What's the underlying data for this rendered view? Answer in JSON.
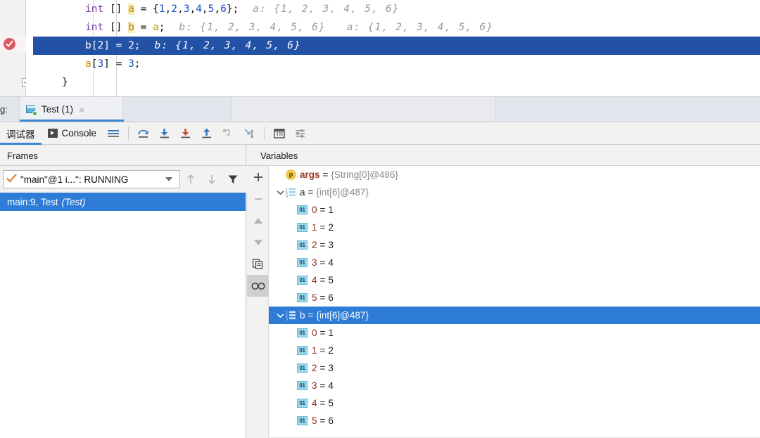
{
  "editor": {
    "lines": [
      {
        "tokens": [
          {
            "t": "int",
            "c": "kw"
          },
          {
            "t": " [] ",
            "c": "plain"
          },
          {
            "t": "a",
            "c": "ident"
          },
          {
            "t": " = {",
            "c": "plain"
          },
          {
            "t": "1",
            "c": "num"
          },
          {
            "t": ",",
            "c": "plain"
          },
          {
            "t": "2",
            "c": "num"
          },
          {
            "t": ",",
            "c": "plain"
          },
          {
            "t": "3",
            "c": "num"
          },
          {
            "t": ",",
            "c": "plain"
          },
          {
            "t": "4",
            "c": "num"
          },
          {
            "t": ",",
            "c": "plain"
          },
          {
            "t": "5",
            "c": "num"
          },
          {
            "t": ",",
            "c": "plain"
          },
          {
            "t": "6",
            "c": "num"
          },
          {
            "t": "};",
            "c": "plain"
          }
        ],
        "hints": [
          "a: {1, 2, 3, 4, 5, 6}"
        ],
        "selected": false,
        "breakpoint": false
      },
      {
        "tokens": [
          {
            "t": "int",
            "c": "kw"
          },
          {
            "t": " [] ",
            "c": "plain"
          },
          {
            "t": "b",
            "c": "ident"
          },
          {
            "t": " = ",
            "c": "plain"
          },
          {
            "t": "a",
            "c": "ident-plain"
          },
          {
            "t": ";",
            "c": "plain"
          }
        ],
        "hints": [
          "b: {1, 2, 3, 4, 5, 6}",
          "a: {1, 2, 3, 4, 5, 6}"
        ],
        "selected": false,
        "breakpoint": false
      },
      {
        "tokens": [
          {
            "t": "b[",
            "c": "plain"
          },
          {
            "t": "2",
            "c": "num"
          },
          {
            "t": "] = ",
            "c": "plain"
          },
          {
            "t": "2",
            "c": "num"
          },
          {
            "t": ";",
            "c": "plain"
          }
        ],
        "hints": [
          "b: {1, 2, 3, 4, 5, 6}"
        ],
        "selected": true,
        "breakpoint": true
      },
      {
        "tokens": [
          {
            "t": "a",
            "c": "ident-plain"
          },
          {
            "t": "[",
            "c": "plain"
          },
          {
            "t": "3",
            "c": "num"
          },
          {
            "t": "] = ",
            "c": "plain"
          },
          {
            "t": "3",
            "c": "num"
          },
          {
            "t": ";",
            "c": "plain"
          }
        ],
        "hints": [],
        "selected": false,
        "breakpoint": false
      },
      {
        "tokens": [
          {
            "t": "}",
            "c": "plain"
          }
        ],
        "hints": [],
        "selected": false,
        "breakpoint": false,
        "outdent": true
      }
    ]
  },
  "tabbar": {
    "prefix_label": "g:",
    "run_tab": {
      "title": "Test (1)",
      "icon": "run-configuration-icon",
      "close": "×",
      "status_dot_color": "#4caf50"
    }
  },
  "debug_toolbar": {
    "tabs": [
      {
        "label": "调试器",
        "icon": null,
        "active": true
      },
      {
        "label": "Console",
        "icon": "console-icon",
        "active": false
      }
    ],
    "buttons": [
      {
        "name": "show-execution-point-icon",
        "title": "Show Execution Point"
      },
      {
        "name": "step-over-icon",
        "title": "Step Over"
      },
      {
        "name": "step-into-icon",
        "title": "Step Into"
      },
      {
        "name": "force-step-into-icon",
        "title": "Force Step Into"
      },
      {
        "name": "step-out-icon",
        "title": "Step Out"
      },
      {
        "name": "drop-frame-icon",
        "title": "Drop Frame"
      },
      {
        "name": "run-to-cursor-icon",
        "title": "Run to Cursor"
      },
      {
        "name": "evaluate-expression-icon",
        "title": "Evaluate Expression"
      },
      {
        "name": "settings-icon",
        "title": "Settings"
      }
    ]
  },
  "frames": {
    "header": "Frames",
    "thread": {
      "label": "\"main\"@1 i...\": RUNNING",
      "status_icon": "check-icon"
    },
    "toolbar": [
      {
        "name": "frame-up-icon"
      },
      {
        "name": "frame-down-icon"
      },
      {
        "name": "filter-icon"
      }
    ],
    "rows": [
      {
        "label": "main:9, Test",
        "suffix": "(Test)",
        "selected": true
      }
    ]
  },
  "variables": {
    "header": "Variables",
    "strip_buttons": [
      {
        "name": "add-watch-icon",
        "glyph": "+",
        "active": false
      },
      {
        "name": "remove-watch-icon",
        "glyph": "−",
        "active": false
      },
      {
        "name": "move-up-icon",
        "glyph": "▲",
        "active": false
      },
      {
        "name": "move-down-icon",
        "glyph": "▼",
        "active": false
      },
      {
        "name": "copy-value-icon",
        "glyph": "copy",
        "active": false
      },
      {
        "name": "inline-watches-icon",
        "glyph": "glasses",
        "active": true
      }
    ],
    "rows": [
      {
        "indent": 1,
        "chevron": "",
        "icon": "param",
        "icon_text": "p",
        "name": "args",
        "eq": "=",
        "value": "{String[0]@486}",
        "value_dark": false,
        "selected": false
      },
      {
        "indent": 0,
        "chevron": "⌄",
        "icon": "array",
        "icon_text": "",
        "name": "a",
        "eq": "=",
        "value": "{int[6]@487}",
        "value_dark": false,
        "selected": false,
        "plainname": true
      },
      {
        "indent": 2,
        "chevron": "",
        "icon": "prim",
        "icon_text": "01",
        "name": "0",
        "eq": "=",
        "value": "1",
        "value_dark": true,
        "selected": false,
        "isindex": true
      },
      {
        "indent": 2,
        "chevron": "",
        "icon": "prim",
        "icon_text": "01",
        "name": "1",
        "eq": "=",
        "value": "2",
        "value_dark": true,
        "selected": false,
        "isindex": true
      },
      {
        "indent": 2,
        "chevron": "",
        "icon": "prim",
        "icon_text": "01",
        "name": "2",
        "eq": "=",
        "value": "3",
        "value_dark": true,
        "selected": false,
        "isindex": true
      },
      {
        "indent": 2,
        "chevron": "",
        "icon": "prim",
        "icon_text": "01",
        "name": "3",
        "eq": "=",
        "value": "4",
        "value_dark": true,
        "selected": false,
        "isindex": true
      },
      {
        "indent": 2,
        "chevron": "",
        "icon": "prim",
        "icon_text": "01",
        "name": "4",
        "eq": "=",
        "value": "5",
        "value_dark": true,
        "selected": false,
        "isindex": true
      },
      {
        "indent": 2,
        "chevron": "",
        "icon": "prim",
        "icon_text": "01",
        "name": "5",
        "eq": "=",
        "value": "6",
        "value_dark": true,
        "selected": false,
        "isindex": true
      },
      {
        "indent": 0,
        "chevron": "⌄",
        "icon": "array",
        "icon_text": "",
        "name": "b",
        "eq": "=",
        "value": "{int[6]@487}",
        "value_dark": false,
        "selected": true,
        "plainname": true
      },
      {
        "indent": 2,
        "chevron": "",
        "icon": "prim",
        "icon_text": "01",
        "name": "0",
        "eq": "=",
        "value": "1",
        "value_dark": true,
        "selected": false,
        "isindex": true
      },
      {
        "indent": 2,
        "chevron": "",
        "icon": "prim",
        "icon_text": "01",
        "name": "1",
        "eq": "=",
        "value": "2",
        "value_dark": true,
        "selected": false,
        "isindex": true
      },
      {
        "indent": 2,
        "chevron": "",
        "icon": "prim",
        "icon_text": "01",
        "name": "2",
        "eq": "=",
        "value": "3",
        "value_dark": true,
        "selected": false,
        "isindex": true
      },
      {
        "indent": 2,
        "chevron": "",
        "icon": "prim",
        "icon_text": "01",
        "name": "3",
        "eq": "=",
        "value": "4",
        "value_dark": true,
        "selected": false,
        "isindex": true
      },
      {
        "indent": 2,
        "chevron": "",
        "icon": "prim",
        "icon_text": "01",
        "name": "4",
        "eq": "=",
        "value": "5",
        "value_dark": true,
        "selected": false,
        "isindex": true
      },
      {
        "indent": 2,
        "chevron": "",
        "icon": "prim",
        "icon_text": "01",
        "name": "5",
        "eq": "=",
        "value": "6",
        "value_dark": true,
        "selected": false,
        "isindex": true
      }
    ]
  },
  "colors": {
    "selection_blue": "#2251a6",
    "tree_selection_blue": "#2e7cd6",
    "accent_underline": "#3e86d6",
    "breakpoint_red": "#db5860",
    "keyword_purple": "#7a3ea1",
    "number_blue": "#1750c8",
    "hint_gray": "#999999"
  }
}
